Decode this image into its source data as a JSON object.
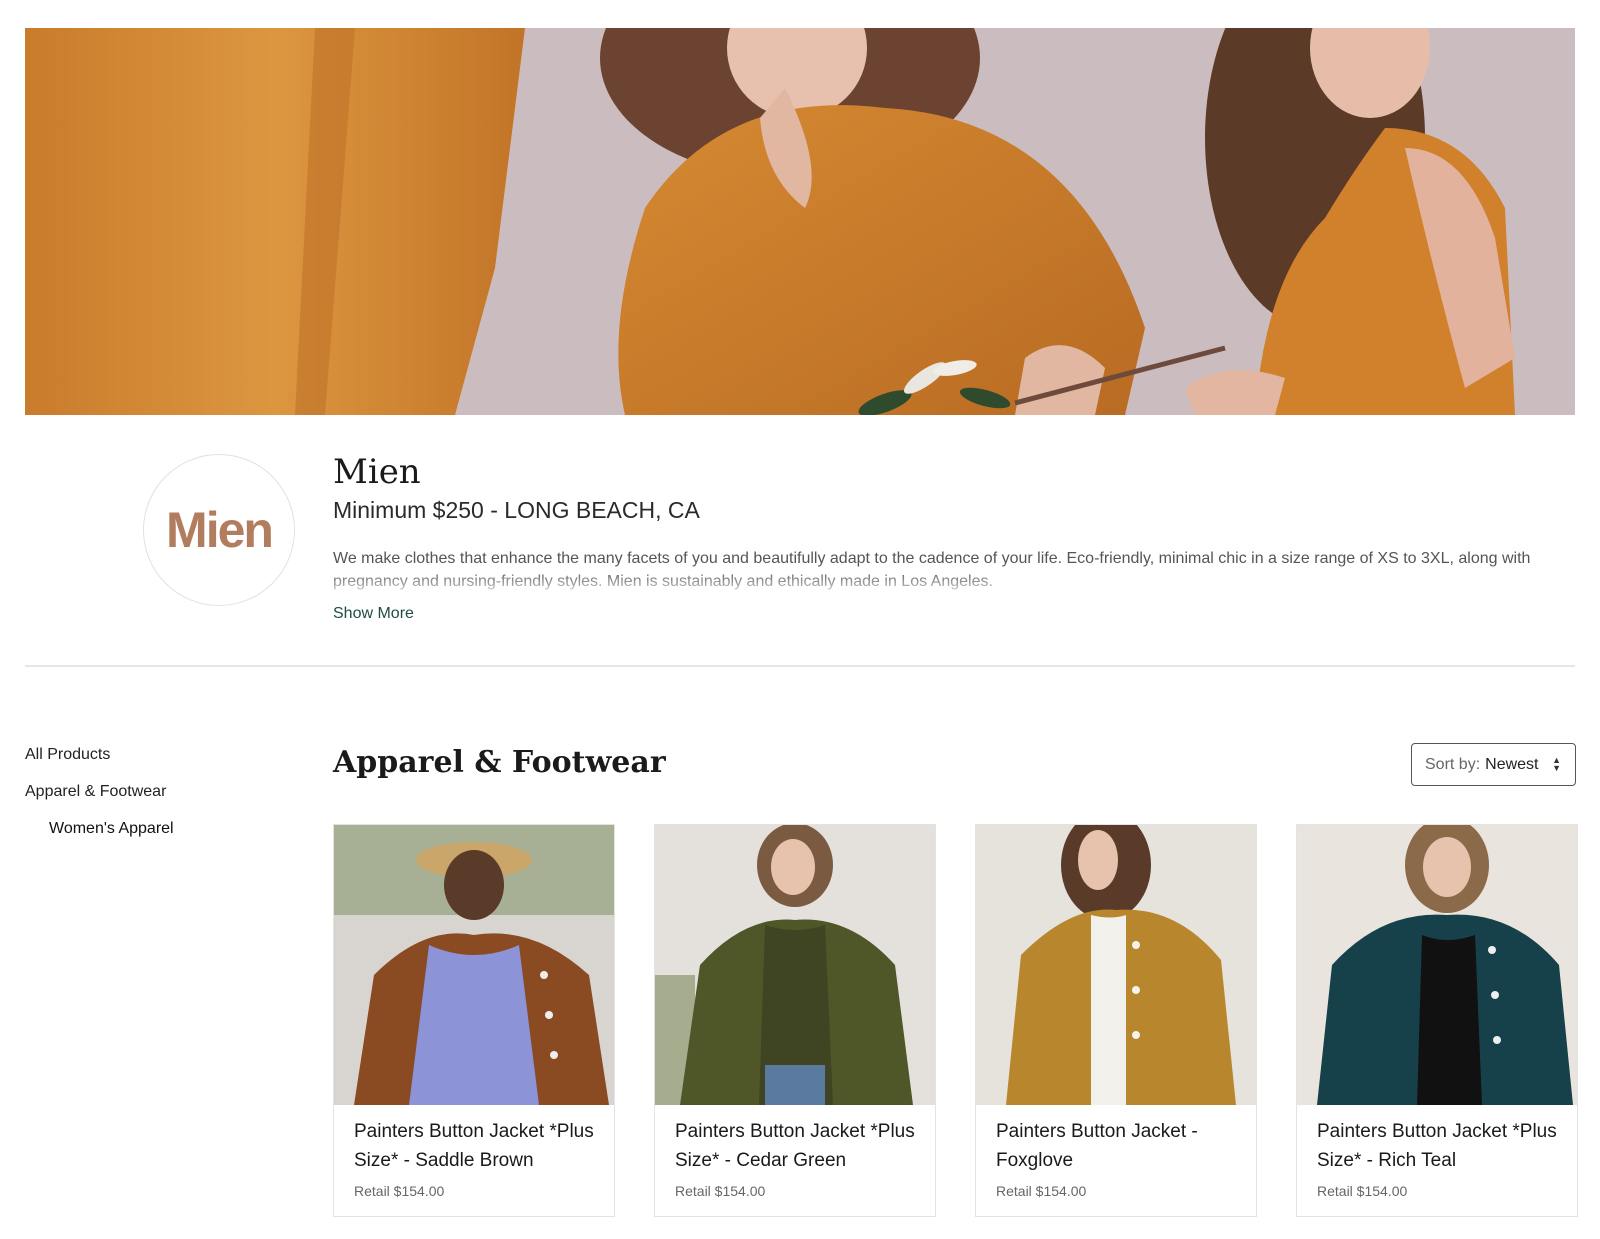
{
  "hero": {
    "alt": "Models wearing rust orange outfits"
  },
  "brand": {
    "logo_text": "Mien",
    "name": "Mien",
    "subtitle": "Minimum $250 - LONG BEACH, CA",
    "description": "We make clothes that enhance the many facets of you and beautifully adapt to the cadence of your life. Eco-friendly, minimal chic in a size range of XS to 3XL, along with pregnancy and nursing-friendly styles. Mien is sustainably and ethically made in Los Angeles.",
    "show_more": "Show More",
    "logo_color": "#b27d5f"
  },
  "sidebar": {
    "items": [
      {
        "label": "All Products"
      },
      {
        "label": "Apparel & Footwear"
      },
      {
        "label": "Women's Apparel"
      }
    ]
  },
  "section": {
    "title": "Apparel & Footwear"
  },
  "sort": {
    "label": "Sort by:",
    "value": "Newest"
  },
  "products": [
    {
      "title": "Painters Button Jacket *Plus Size* - Saddle Brown",
      "price": "Retail $154.00",
      "color": "#8a4a22"
    },
    {
      "title": "Painters Button Jacket *Plus Size* - Cedar Green",
      "price": "Retail $154.00",
      "color": "#4f5628"
    },
    {
      "title": "Painters Button Jacket - Foxglove",
      "price": "Retail $154.00",
      "color": "#b8862d"
    },
    {
      "title": "Painters Button Jacket *Plus Size* - Rich Teal",
      "price": "Retail $154.00",
      "color": "#16414a"
    }
  ]
}
